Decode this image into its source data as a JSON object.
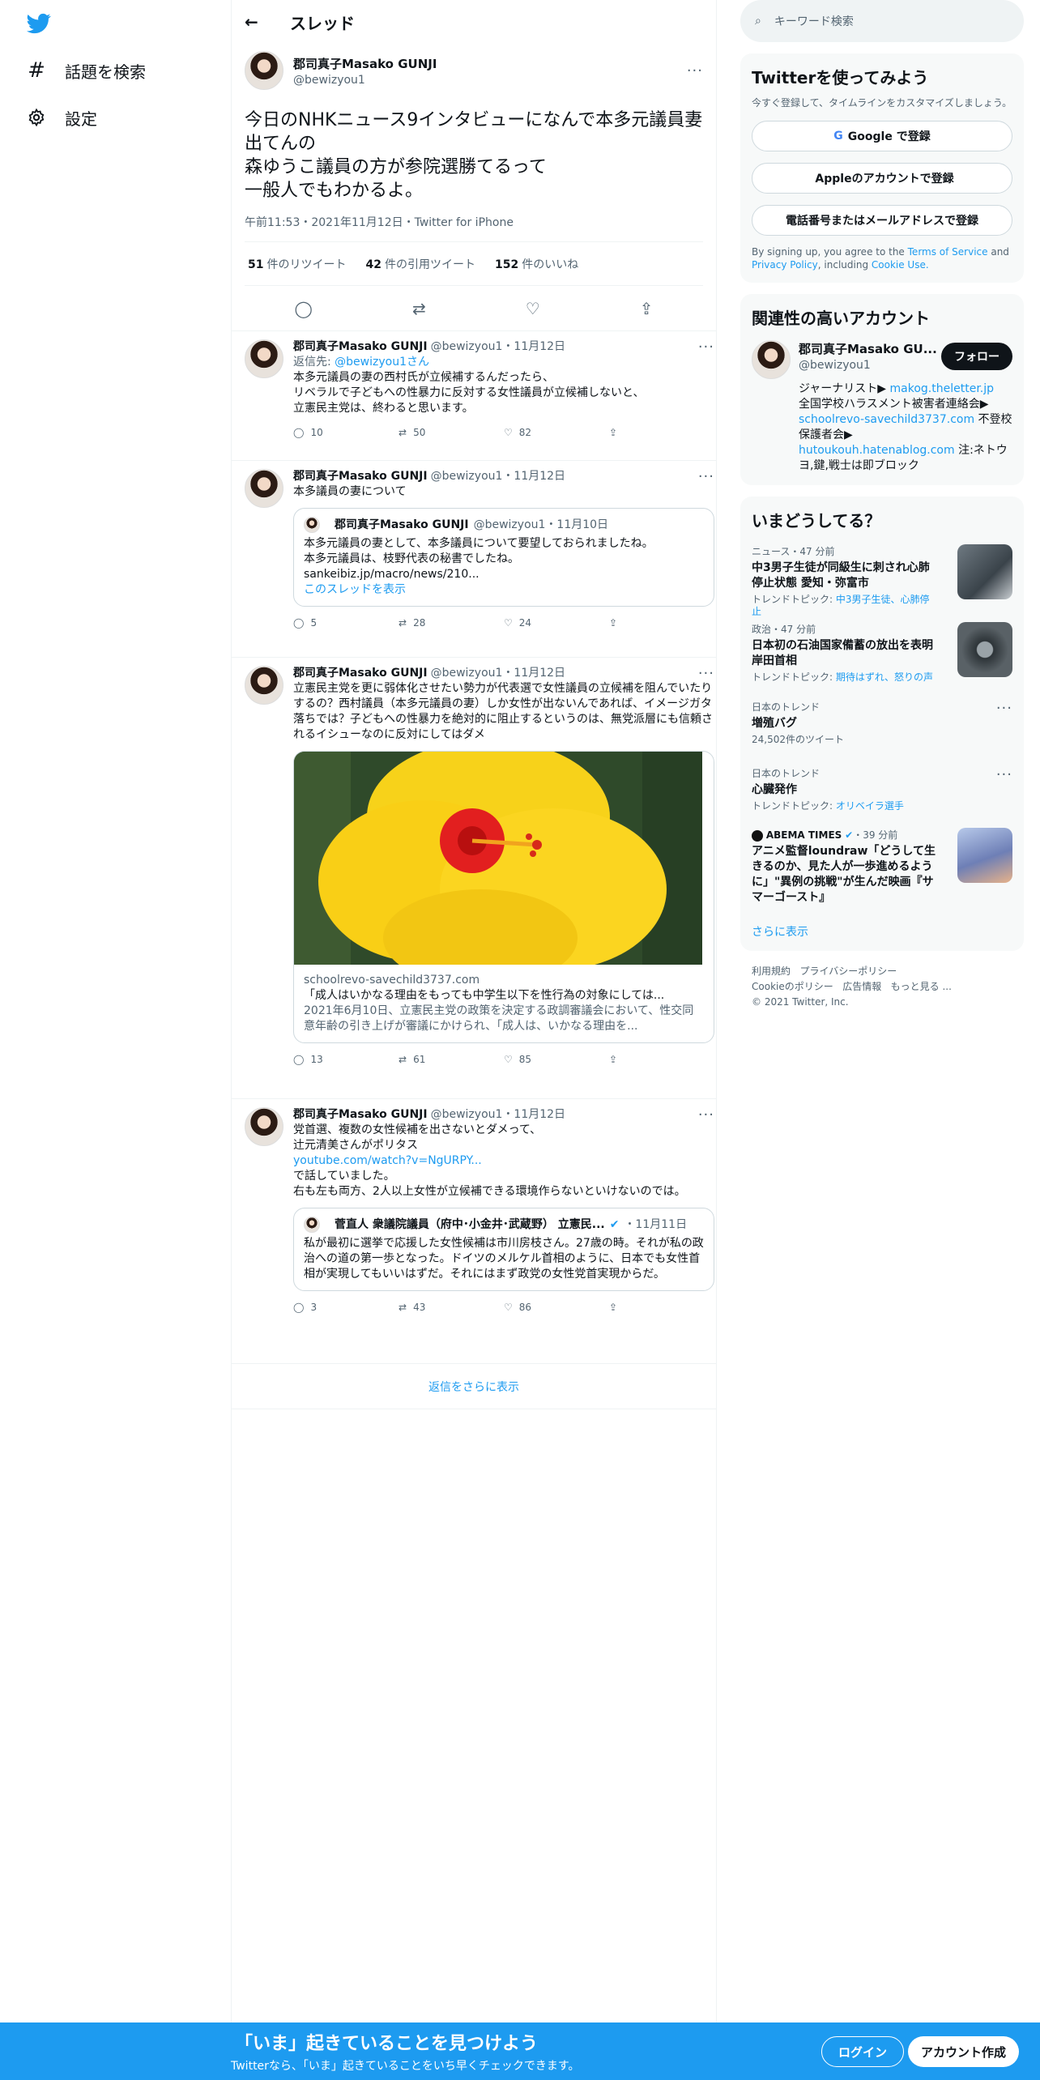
{
  "nav": {
    "explore": "話題を検索",
    "settings": "設定"
  },
  "header": {
    "title": "スレッド"
  },
  "focal": {
    "name": "郡司真子Masako GUNJI",
    "handle": "@bewizyou1",
    "text": [
      "今日のNHKニュース9インタビューになんで本多元議員妻出てんの",
      "森ゆうこ議員の方が参院選勝てるって",
      "一般人でもわかるよ。"
    ],
    "meta": "午前11:53・2021年11月12日・Twitter for iPhone",
    "rt": "51",
    "rt_label": "件のリツイート",
    "qt": "42",
    "qt_label": "件の引用ツイート",
    "likes": "152",
    "likes_label": "件のいいね"
  },
  "replies": [
    {
      "name": "郡司真子Masako GUNJI",
      "meta": "@bewizyou1・11月12日",
      "reply_to": "返信先: ",
      "reply_handle": "@bewizyou1",
      "reply_suffix": "さん",
      "text": [
        "本多元議員の妻の西村氏が立候補するんだったら、",
        "リベラルで子どもへの性暴力に反対する女性議員が立候補しないと、",
        "立憲民主党は、終わると思います。"
      ],
      "replies": "10",
      "rts": "50",
      "likes": "82"
    },
    {
      "name": "郡司真子Masako GUNJI",
      "meta": "@bewizyou1・11月12日",
      "text": [
        "本多議員の妻について"
      ],
      "quote": {
        "name": "郡司真子Masako GUNJI",
        "meta": "@bewizyou1・11月10日",
        "text": [
          "本多元議員の妻として、本多議員について要望しておられましたね。",
          "本多元議員は、枝野代表の秘書でしたね。",
          "sankeibiz.jp/macro/news/210..."
        ],
        "link": "このスレッドを表示"
      },
      "replies": "5",
      "rts": "28",
      "likes": "24"
    },
    {
      "name": "郡司真子Masako GUNJI",
      "meta": "@bewizyou1・11月12日",
      "text": [
        "立憲民主党を更に弱体化させたい勢力が代表選で女性議員の立候補を阻んでいたりするの？西村議員（本多元議員の妻）しか女性が出ないんであれば、イメージガタ落ちでは？子どもへの性暴力を絶対的に阻止するというのは、無党派層にも信頼されるイシューなのに反対にしてはダメ"
      ],
      "card": {
        "domain": "schoolrevo-savechild3737.com",
        "title": "「成人はいかなる理由をもっても中学生以下を性行為の対象にしては...",
        "desc": "2021年6月10日、立憲民主党の政策を決定する政調審議会において、性交同意年齢の引き上げが審議にかけられ、「成人は、いかなる理由を..."
      },
      "replies": "13",
      "rts": "61",
      "likes": "85"
    },
    {
      "name": "郡司真子Masako GUNJI",
      "meta": "@bewizyou1・11月12日",
      "text": [
        "党首選、複数の女性候補を出さないとダメって、",
        "辻元清美さんがポリタス"
      ],
      "link": "youtube.com/watch?v=NgURPY...",
      "text2": [
        "で話していました。",
        "右も左も両方、2人以上女性が立候補できる環境作らないといけないのでは。"
      ],
      "quote": {
        "name": "菅直人 衆議院議員（府中･小金井･武蔵野） 立憲民...",
        "meta": "・11月11日",
        "text": [
          "私が最初に選挙で応援した女性候補は市川房枝さん。27歳の時。それが私の政治への道の第一歩となった。ドイツのメルケル首相のように、日本でも女性首相が実現してもいいはずだ。それにはまず政党の女性党首実現からだ。"
        ]
      },
      "replies": "3",
      "rts": "43",
      "likes": "86"
    }
  ],
  "show_more": "返信をさらに表示",
  "right": {
    "search_placeholder": "キーワード検索",
    "signup": {
      "title": "Twitterを使ってみよう",
      "sub": "今すぐ登録して、タイムラインをカスタマイズしましょう。",
      "google": "Google で登録",
      "apple": "Appleのアカウントで登録",
      "phone": "電話番号またはメールアドレスで登録",
      "terms_pre": "By signing up, you agree to the ",
      "terms_tos": "Terms of Service",
      "terms_and": " and ",
      "terms_pp": "Privacy Policy",
      "terms_inc": ", including ",
      "terms_cookie": "Cookie Use."
    },
    "related": {
      "title": "関連性の高いアカウント",
      "name": "郡司真子Masako GU...",
      "handle": "@bewizyou1",
      "follow": "フォロー",
      "bio1": "ジャーナリスト▶ ",
      "bio_link1": "makog.theletter.jp",
      "bio2": "全国学校ハラスメント被害者連絡会▶",
      "bio_link2": "schoolrevo-savechild3737.com",
      "bio3": " 不登校保護者会▶",
      "bio_link3": "hutoukouh.hatenablog.com",
      "bio4": " 注:ネトウヨ,鍵,戦士は即ブロック"
    },
    "trends": {
      "title": "いまどうしてる？",
      "items": [
        {
          "cat": "ニュース・47 分前",
          "title": "中3男子生徒が同級生に刺され心肺停止状態 愛知・弥富市",
          "tt_pre": "トレンドトピック: ",
          "tt": "中3男子生徒、心肺停止"
        },
        {
          "cat": "政治・47 分前",
          "title": "日本初の石油国家備蓄の放出を表明 岸田首相",
          "tt_pre": "トレンドトピック: ",
          "tt": "期待はずれ、怒りの声"
        },
        {
          "cat": "日本のトレンド",
          "title": "増殖バグ",
          "tt_plain": "24,502件のツイート"
        },
        {
          "cat": "日本のトレンド",
          "title": "心臓発作",
          "tt_pre": "トレンドトピック: ",
          "tt": "オリベイラ選手"
        },
        {
          "cat": "ABEMA TIMES",
          "cat_time": "・39 分前",
          "title": "アニメ監督loundraw「どうして生きるのか、見た人が一歩進めるように」\"異例の挑戦\"が生んだ映画『サマーゴースト』"
        }
      ],
      "show_more": "さらに表示"
    },
    "footer": {
      "l1": "利用規約",
      "l2": "プライバシーポリシー",
      "l3": "Cookieのポリシー",
      "l4": "広告情報",
      "l5": "もっと見る ...",
      "copy": "© 2021 Twitter, Inc."
    }
  },
  "banner": {
    "title": "「いま」起きていることを見つけよう",
    "sub": "Twitterなら、「いま」起きていることをいち早くチェックできます。",
    "login": "ログイン",
    "signup": "アカウント作成"
  }
}
